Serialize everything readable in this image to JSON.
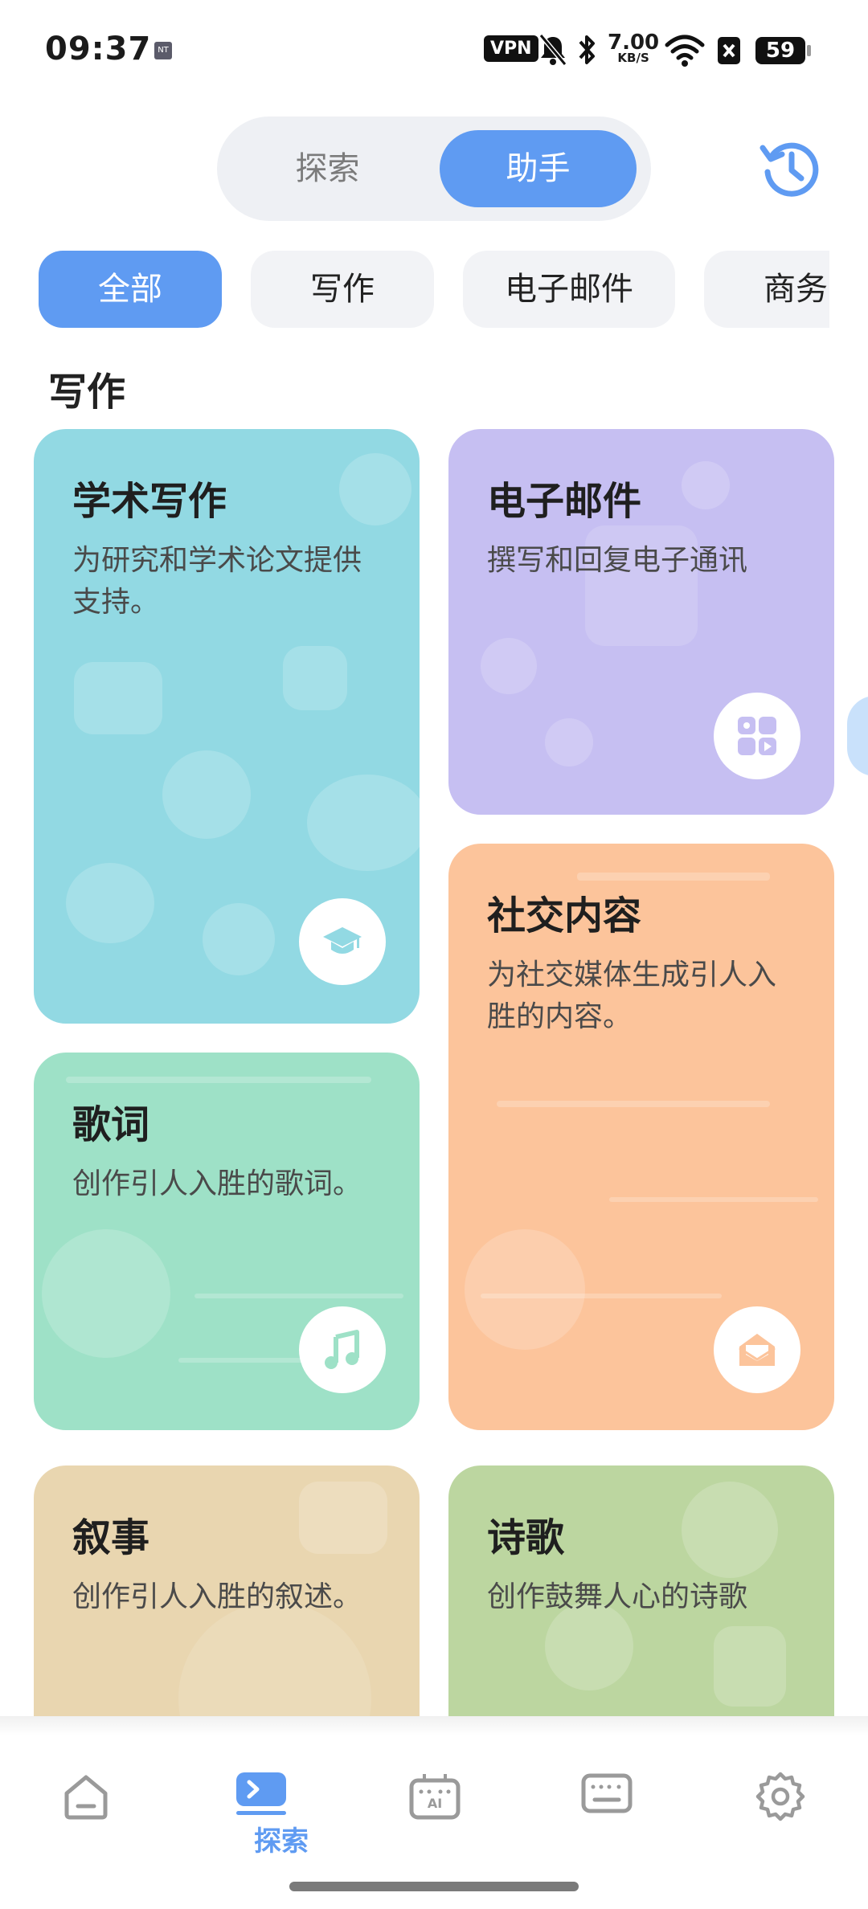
{
  "status_bar": {
    "time": "09:37",
    "mini_icon_text": "NT",
    "vpn": "VPN",
    "speed_value": "7.00",
    "speed_unit": "KB/S",
    "battery": "59"
  },
  "segmented": {
    "explore_label": "探索",
    "assistant_label": "助手",
    "selected": "助手"
  },
  "history_icon": "history-clock-icon",
  "chips": [
    {
      "label": "全部",
      "active": true
    },
    {
      "label": "写作",
      "active": false
    },
    {
      "label": "电子邮件",
      "active": false
    },
    {
      "label": "商务",
      "active": false
    }
  ],
  "section_title": "写作",
  "cards": [
    {
      "title": "学术写作",
      "desc": "为研究和学术论文提供支持。",
      "color": "#92d9e3",
      "icon": "graduation-cap-icon"
    },
    {
      "title": "电子邮件",
      "desc": "撰写和回复电子通讯",
      "color": "#c6bff2",
      "icon": "apps-grid-icon"
    },
    {
      "title": "社交内容",
      "desc": "为社交媒体生成引人入胜的内容。",
      "color": "#fcc49b",
      "icon": "envelope-icon"
    },
    {
      "title": "歌词",
      "desc": "创作引人入胜的歌词。",
      "color": "#9ee1c7",
      "icon": "music-note-icon"
    },
    {
      "title": "叙事",
      "desc": "创作引人入胜的叙述。",
      "color": "#e9d6b0",
      "icon": "none"
    },
    {
      "title": "诗歌",
      "desc": "创作鼓舞人心的诗歌",
      "color": "#bcd6a0",
      "icon": "none"
    }
  ],
  "bottom_nav": {
    "items": [
      "home-icon",
      "explore-terminal-icon",
      "ai-keyboard-icon",
      "keyboard-icon",
      "settings-gear-icon"
    ],
    "active_label": "探索"
  },
  "colors": {
    "accent": "#5f9bf2",
    "chip_bg": "#f2f3f6",
    "segment_bg": "#eef0f4"
  }
}
